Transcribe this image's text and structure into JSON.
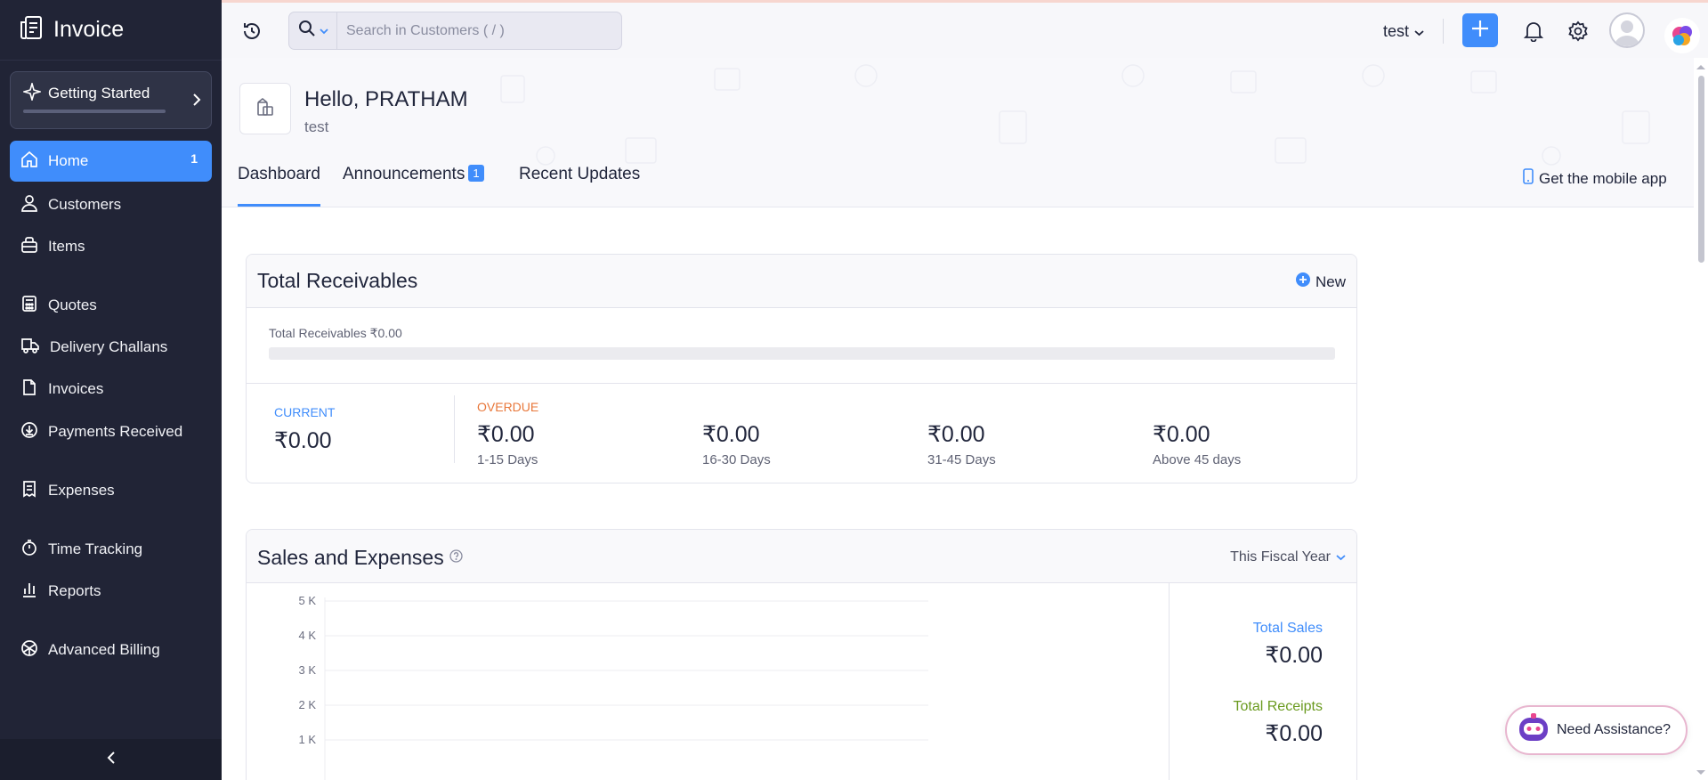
{
  "app": {
    "title": "Invoice"
  },
  "sidebar": {
    "getting_started": "Getting Started",
    "getting_started_progress": 0,
    "items": [
      {
        "label": "Home",
        "icon": "home-icon",
        "badge": "1",
        "active": true
      },
      {
        "label": "Customers",
        "icon": "user-icon"
      },
      {
        "label": "Items",
        "icon": "basket-icon"
      },
      {
        "label": "Quotes",
        "icon": "calculator-icon"
      },
      {
        "label": "Delivery Challans",
        "icon": "truck-icon"
      },
      {
        "label": "Invoices",
        "icon": "invoice-icon"
      },
      {
        "label": "Payments Received",
        "icon": "payment-icon"
      },
      {
        "label": "Expenses",
        "icon": "receipt-icon"
      },
      {
        "label": "Time Tracking",
        "icon": "stopwatch-icon"
      },
      {
        "label": "Reports",
        "icon": "bar-chart-icon"
      },
      {
        "label": "Advanced Billing",
        "icon": "billing-icon"
      }
    ]
  },
  "header": {
    "search_placeholder": "Search in Customers ( / )",
    "org_name": "test"
  },
  "hero": {
    "greeting": "Hello, PRATHAM",
    "org": "test",
    "tabs": [
      {
        "label": "Dashboard",
        "active": true
      },
      {
        "label": "Announcements",
        "badge": "1"
      },
      {
        "label": "Recent Updates"
      }
    ],
    "mobile_app": "Get the mobile app"
  },
  "receivables": {
    "title": "Total Receivables",
    "new_label": "New",
    "summary": "Total Receivables ₹0.00",
    "current_label": "CURRENT",
    "current_amount": "₹0.00",
    "overdue_label": "OVERDUE",
    "buckets": [
      {
        "amount": "₹0.00",
        "days": "1-15 Days"
      },
      {
        "amount": "₹0.00",
        "days": "16-30 Days"
      },
      {
        "amount": "₹0.00",
        "days": "31-45 Days"
      },
      {
        "amount": "₹0.00",
        "days": "Above 45 days"
      }
    ]
  },
  "sales": {
    "title": "Sales and Expenses",
    "period": "This Fiscal Year",
    "total_sales_label": "Total Sales",
    "total_sales": "₹0.00",
    "total_receipts_label": "Total Receipts",
    "total_receipts": "₹0.00"
  },
  "chart_data": {
    "type": "bar",
    "y_ticks": [
      "5 K",
      "4 K",
      "3 K",
      "2 K",
      "1 K"
    ],
    "ylim": [
      0,
      5000
    ]
  },
  "assistant": {
    "label": "Need Assistance?"
  },
  "colors": {
    "accent": "#408dfb",
    "sidebar_bg": "#212436",
    "overdue": "#e8773a",
    "current": "#408dfb",
    "receipts": "#6a9a1f"
  }
}
